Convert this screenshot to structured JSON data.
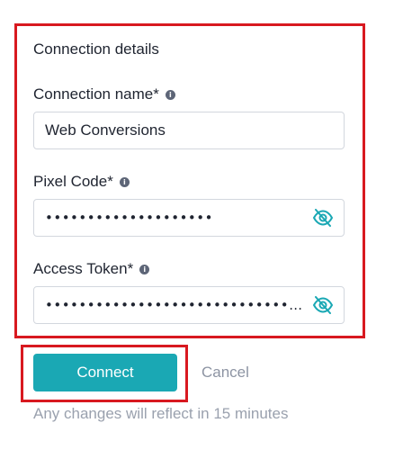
{
  "form": {
    "section_title": "Connection details",
    "connection_name": {
      "label": "Connection name*",
      "value": "Web Conversions"
    },
    "pixel_code": {
      "label": "Pixel Code*",
      "masked_value": "••••••••••••••••••••"
    },
    "access_token": {
      "label": "Access Token*",
      "masked_value": "••••••••••••••••••••••••••••••..."
    }
  },
  "actions": {
    "connect_label": "Connect",
    "cancel_label": "Cancel"
  },
  "footnote": "Any changes will reflect in 15 minutes",
  "icons": {
    "info": "info-icon",
    "visibility_toggle": "eye-slash-icon"
  },
  "colors": {
    "primary": "#1aa8b4",
    "highlight": "#d81920",
    "muted_text": "#8d94a3"
  }
}
